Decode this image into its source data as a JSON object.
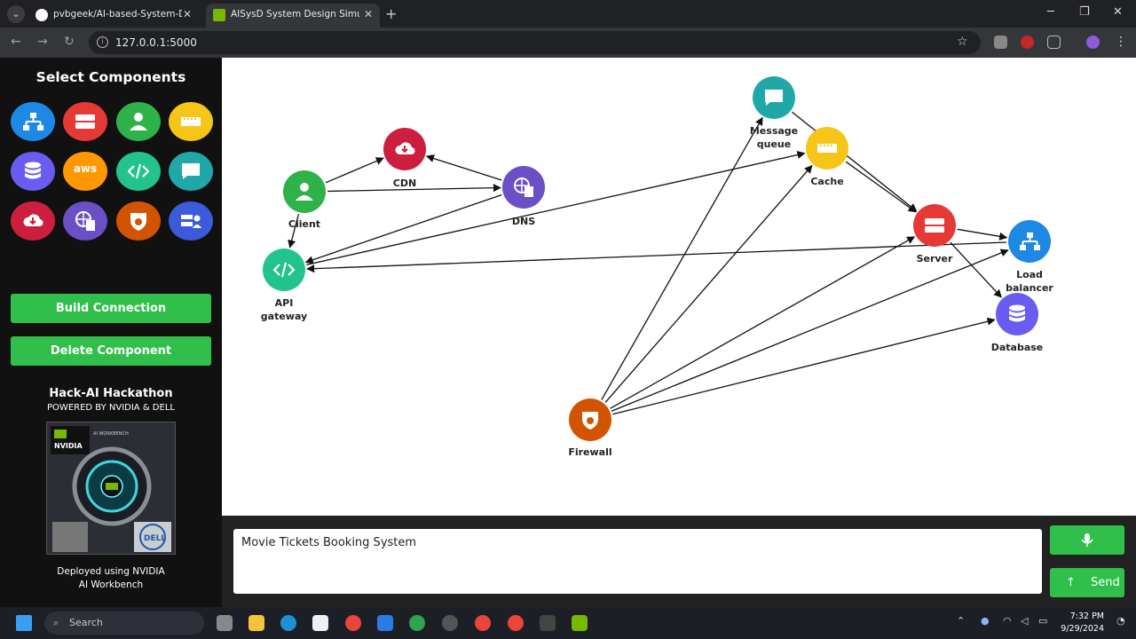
{
  "browser": {
    "tabs": [
      {
        "label": "pvbgeek/AI-based-System-Des"
      },
      {
        "label": "AISysD System Design Simulato"
      }
    ],
    "url": "127.0.0.1:5000"
  },
  "sidebar": {
    "title": "Select Components",
    "components": [
      {
        "name": "load-balancer",
        "color": "#1e88e5"
      },
      {
        "name": "server",
        "color": "#e53935"
      },
      {
        "name": "client",
        "color": "#2fb24a"
      },
      {
        "name": "cache",
        "color": "#f5c518"
      },
      {
        "name": "database",
        "color": "#6a5cf0"
      },
      {
        "name": "aws",
        "color": "#ff9800",
        "label": "aws"
      },
      {
        "name": "api-gateway",
        "color": "#22c38e"
      },
      {
        "name": "message-queue",
        "color": "#20a8a8"
      },
      {
        "name": "cdn",
        "color": "#cc1f3f"
      },
      {
        "name": "dns",
        "color": "#6a4fc5"
      },
      {
        "name": "firewall",
        "color": "#d35400"
      },
      {
        "name": "users",
        "color": "#3b5bdb"
      }
    ],
    "build_button": "Build Connection",
    "delete_button": "Delete Component",
    "hackathon_title": "Hack-AI Hackathon",
    "hackathon_sub": "POWERED BY NVIDIA & DELL",
    "deployed_line1": "Deployed using NVIDIA",
    "deployed_line2": "AI Workbench",
    "image_text": {
      "nvidia": "NVIDIA",
      "workbench": "AI WORKBENCH",
      "dell": "DELL"
    }
  },
  "diagram": {
    "nodes": [
      {
        "id": "client",
        "label": "Client",
        "color": "#2fb24a"
      },
      {
        "id": "cdn",
        "label": "CDN",
        "color": "#cc1f3f"
      },
      {
        "id": "dns",
        "label": "DNS",
        "color": "#6a4fc5"
      },
      {
        "id": "api",
        "label": "API gateway",
        "color": "#22c38e"
      },
      {
        "id": "mq",
        "label": "Message queue",
        "color": "#20a8a8"
      },
      {
        "id": "cache",
        "label": "Cache",
        "color": "#f5c518"
      },
      {
        "id": "server",
        "label": "Server",
        "color": "#e53935"
      },
      {
        "id": "lb",
        "label": "Load balancer",
        "color": "#1e88e5"
      },
      {
        "id": "db",
        "label": "Database",
        "color": "#6a5cf0"
      },
      {
        "id": "fw",
        "label": "Firewall",
        "color": "#d35400"
      }
    ],
    "edges": [
      [
        "client",
        "cdn"
      ],
      [
        "dns",
        "cdn"
      ],
      [
        "client",
        "dns"
      ],
      [
        "client",
        "api"
      ],
      [
        "dns",
        "api"
      ],
      [
        "api",
        "cache"
      ],
      [
        "lb",
        "api"
      ],
      [
        "mq",
        "server"
      ],
      [
        "cache",
        "server"
      ],
      [
        "server",
        "lb"
      ],
      [
        "server",
        "db"
      ],
      [
        "fw",
        "mq"
      ],
      [
        "fw",
        "cache"
      ],
      [
        "fw",
        "server"
      ],
      [
        "fw",
        "lb"
      ],
      [
        "fw",
        "db"
      ]
    ]
  },
  "chat": {
    "prompt": "Movie Tickets Booking System",
    "send": "Send"
  },
  "taskbar": {
    "search": "Search",
    "time": "7:32 PM",
    "date": "9/29/2024"
  }
}
